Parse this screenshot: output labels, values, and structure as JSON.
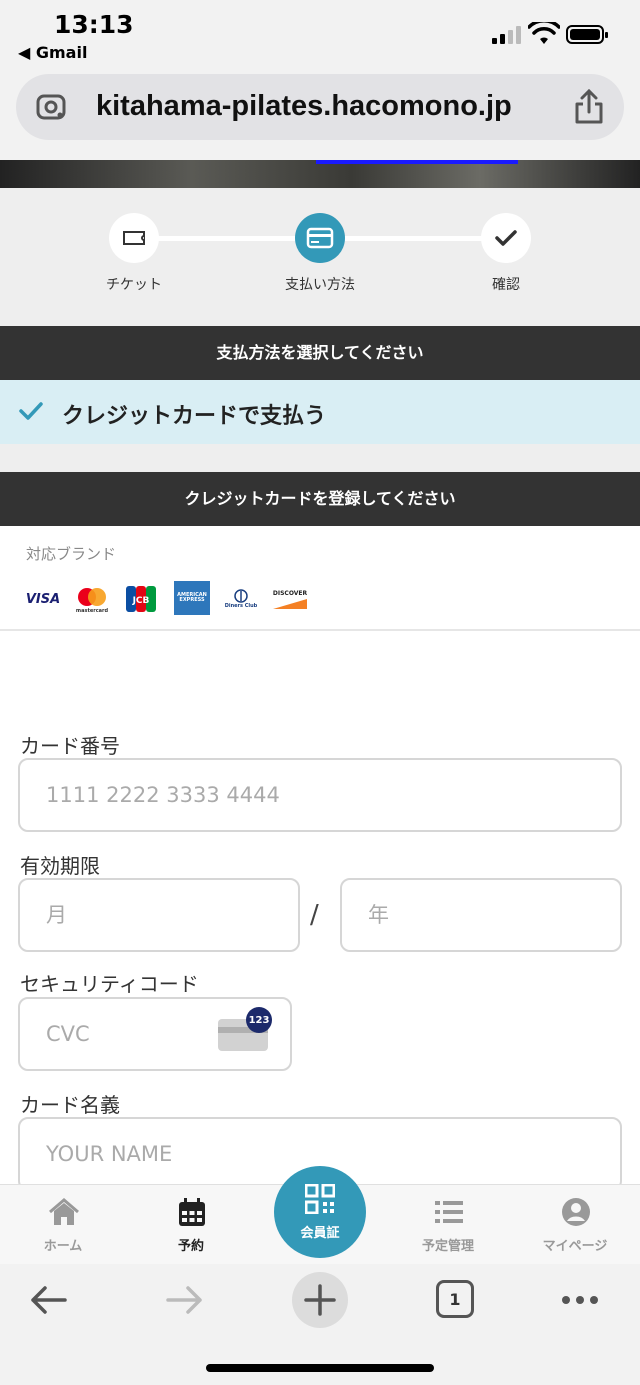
{
  "status_bar": {
    "time": "13:13",
    "back_app": "◀ Gmail"
  },
  "browser": {
    "url": "kitahama-pilates.hacomono.jp"
  },
  "steps": [
    {
      "label": "チケット",
      "icon": "ticket-icon",
      "state": "done"
    },
    {
      "label": "支払い方法",
      "icon": "credit-card-icon",
      "state": "active"
    },
    {
      "label": "確認",
      "icon": "check-icon",
      "state": "pending"
    }
  ],
  "payment": {
    "section_title": "支払方法を選択してください",
    "selected_method": "クレジットカードで支払う"
  },
  "card_form": {
    "section_title": "クレジットカードを登録してください",
    "brands_title": "対応ブランド",
    "brands": [
      "VISA",
      "mastercard",
      "JCB",
      "AMERICAN EXPRESS",
      "Diners Club",
      "DISCOVER"
    ],
    "card_number_label": "カード番号",
    "card_number_placeholder": "1111 2222 3333 4444",
    "expiry_label": "有効期限",
    "month_placeholder": "月",
    "year_placeholder": "年",
    "slash": "/",
    "cvc_label": "セキュリティコード",
    "cvc_placeholder": "CVC",
    "cvc_badge": "123",
    "name_label": "カード名義",
    "name_placeholder": "YOUR NAME"
  },
  "tabbar": {
    "home": "ホーム",
    "reserve": "予約",
    "member": "会員証",
    "schedule": "予定管理",
    "mypage": "マイページ"
  },
  "toolbar": {
    "tab_count": "1"
  },
  "colors": {
    "accent": "#3399b8",
    "dark_bar": "#333333",
    "selected_bg": "#d9eef4"
  }
}
